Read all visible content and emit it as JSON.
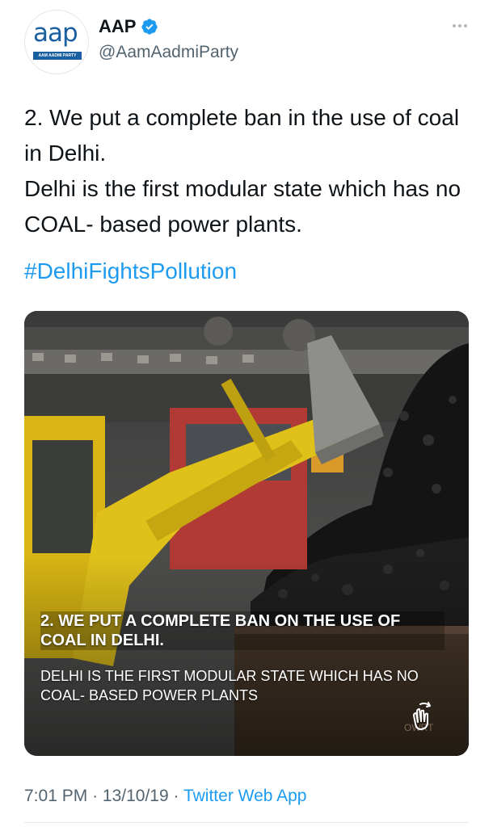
{
  "author": {
    "avatar_text": "aap",
    "avatar_band_text": "AAM AADMI PARTY",
    "display_name": "AAP",
    "handle": "@AamAadmiParty",
    "verified": true
  },
  "tweet": {
    "line1": "2. We put a complete ban in the use of coal in Delhi.",
    "line2": "Delhi is the first modular state which has no COAL- based power plants.",
    "hashtag": "#DelhiFightsPollution"
  },
  "media": {
    "overlay_title": "2. WE PUT A COMPLETE BAN ON THE USE OF COAL IN DELHI.",
    "overlay_subtitle": "DELHI IS THE FIRST MODULAR STATE WHICH HAS NO COAL- BASED POWER PLANTS",
    "truck_text": "OWRT"
  },
  "footer": {
    "time": "7:01 PM",
    "separator": "·",
    "date": "13/10/19",
    "source": "Twitter Web App"
  },
  "colors": {
    "link": "#1d9bf0",
    "muted": "#536471",
    "brand": "#1a5fa0"
  },
  "icons": [
    "verified-badge-icon",
    "more-options-icon",
    "hand-pointer-icon"
  ]
}
